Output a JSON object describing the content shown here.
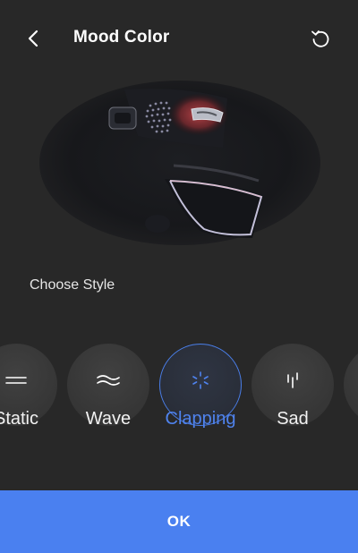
{
  "header": {
    "title": "Mood Color",
    "back_icon": "chevron-left-icon",
    "reset_icon": "reset-icon"
  },
  "hero": {
    "image": "car-door-ambient-light-photo"
  },
  "section": {
    "label": "Choose Style"
  },
  "styles": [
    {
      "label": "Static",
      "icon": "static-lines-icon",
      "selected": false
    },
    {
      "label": "Wave",
      "icon": "wave-icon",
      "selected": false
    },
    {
      "label": "Clapping",
      "icon": "clapping-burst-icon",
      "selected": true
    },
    {
      "label": "Sad",
      "icon": "sad-drops-icon",
      "selected": false
    },
    {
      "label": "",
      "icon": "",
      "selected": false
    }
  ],
  "footer": {
    "ok_label": "OK"
  },
  "colors": {
    "background": "#282828",
    "accent": "#4a80f0",
    "selected_text": "#4f83ee"
  }
}
